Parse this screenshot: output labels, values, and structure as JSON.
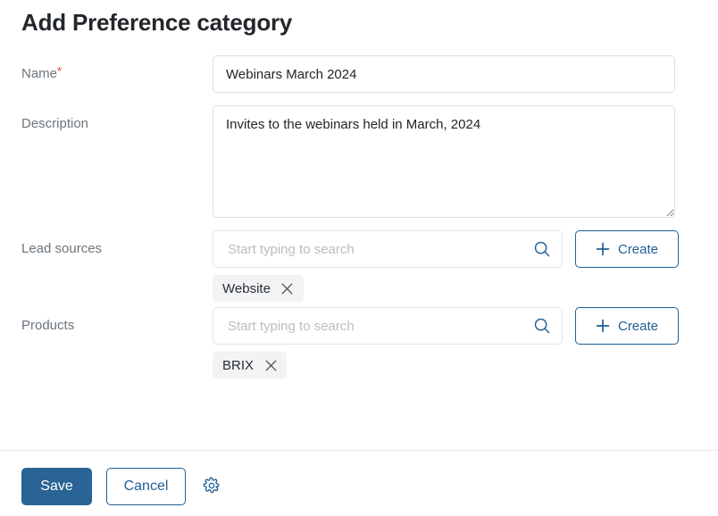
{
  "dialog": {
    "title": "Add Preference category"
  },
  "fields": {
    "name": {
      "label": "Name",
      "required_marker": "*",
      "value": "Webinars March 2024",
      "placeholder": ""
    },
    "description": {
      "label": "Description",
      "value": "Invites to the webinars held in March, 2024",
      "placeholder": ""
    },
    "lead_sources": {
      "label": "Lead sources",
      "value": "",
      "placeholder": "Start typing to search",
      "create_label": "Create",
      "chips": [
        {
          "label": "Website",
          "remove_label": "×"
        }
      ]
    },
    "products": {
      "label": "Products",
      "value": "",
      "placeholder": "Start typing to search",
      "create_label": "Create",
      "chips": [
        {
          "label": "BRIX",
          "remove_label": "×"
        }
      ]
    }
  },
  "footer": {
    "save_label": "Save",
    "cancel_label": "Cancel"
  },
  "icons": {
    "search": "search-icon",
    "plus": "plus-icon",
    "gear": "gear-icon",
    "chip_remove": "close-icon",
    "resize_handle": "resize-handle-icon"
  },
  "colors": {
    "primary_blue": "#2a6496",
    "outline_blue": "#1f5f96",
    "label_gray": "#6c757d",
    "required_red": "#e23b2e",
    "chip_bg": "#f2f3f4",
    "border_gray": "#dcdfe2",
    "divider": "#e7e9eb",
    "placeholder": "#b9bdc2"
  }
}
